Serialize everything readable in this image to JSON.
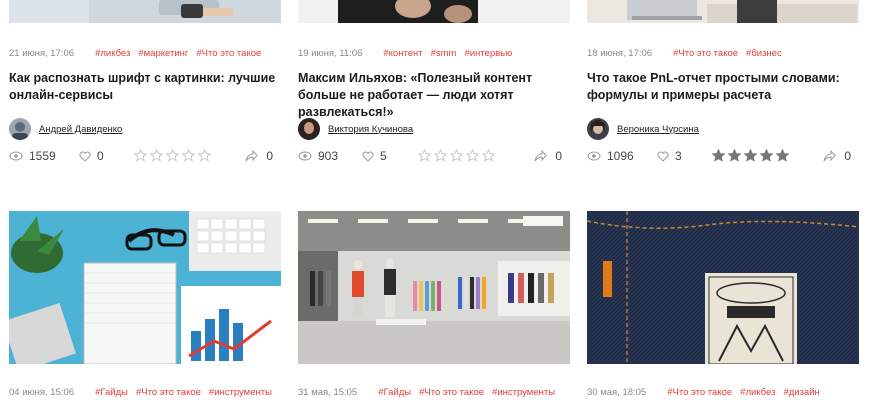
{
  "articles": [
    {
      "date": "21 июня, 17:06",
      "tags": [
        "#ликбез",
        "#маркетинг",
        "#Что это такое"
      ],
      "title": "Как распознать шрифт с картинки: лучшие онлайн-сервисы",
      "author": "Андрей Давиденко",
      "views": "1559",
      "likes": "0",
      "rating": 0,
      "shares": "0"
    },
    {
      "date": "19 июня, 11:06",
      "tags": [
        "#контент",
        "#smm",
        "#интервью"
      ],
      "title": "Максим Ильяхов: «Полезный контент больше не работает — люди хотят развлекаться!»",
      "author": "Виктория Кучинова",
      "views": "903",
      "likes": "5",
      "rating": 0,
      "shares": "0"
    },
    {
      "date": "18 июня, 17:06",
      "tags": [
        "#Что это такое",
        "#бизнес"
      ],
      "title": "Что такое PnL-отчет простыми словами: формулы и примеры расчета",
      "author": "Вероника Чурсина",
      "views": "1096",
      "likes": "3",
      "rating": 5,
      "shares": "0"
    }
  ],
  "bottom_articles": [
    {
      "date": "04 июня, 15:06",
      "tags": [
        "#Гайды",
        "#Что это такое",
        "#инструменты"
      ]
    },
    {
      "date": "31 мая, 15:05",
      "tags": [
        "#Гайды",
        "#Что это такое",
        "#инструменты"
      ]
    },
    {
      "date": "30 мая, 18:05",
      "tags": [
        "#Что это такое",
        "#ликбез",
        "#дизайн"
      ]
    }
  ],
  "colors": {
    "tag": "#e63b3b",
    "star_filled": "#777777",
    "star_empty": "#c8c8c8"
  }
}
